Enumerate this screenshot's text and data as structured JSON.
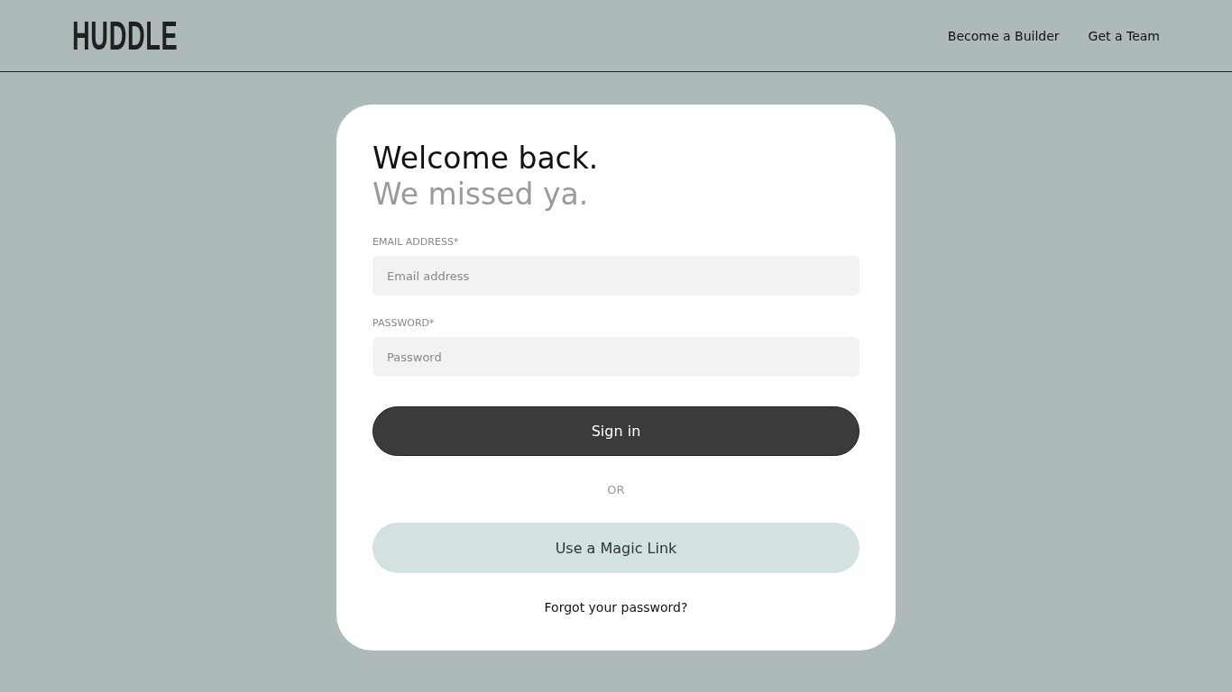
{
  "header": {
    "logo": "HUDDLE",
    "nav": [
      "Become a Builder",
      "Get a Team"
    ]
  },
  "card": {
    "title": "Welcome back.",
    "subtitle": "We missed ya.",
    "fields": [
      {
        "label": "EMAIL ADDRESS*",
        "placeholder": "Email address"
      },
      {
        "label": "PASSWORD*",
        "placeholder": "Password"
      }
    ],
    "sign_in": "Sign in",
    "divider": "OR",
    "magic_link": "Use a Magic Link",
    "forgot": "Forgot your password?"
  }
}
